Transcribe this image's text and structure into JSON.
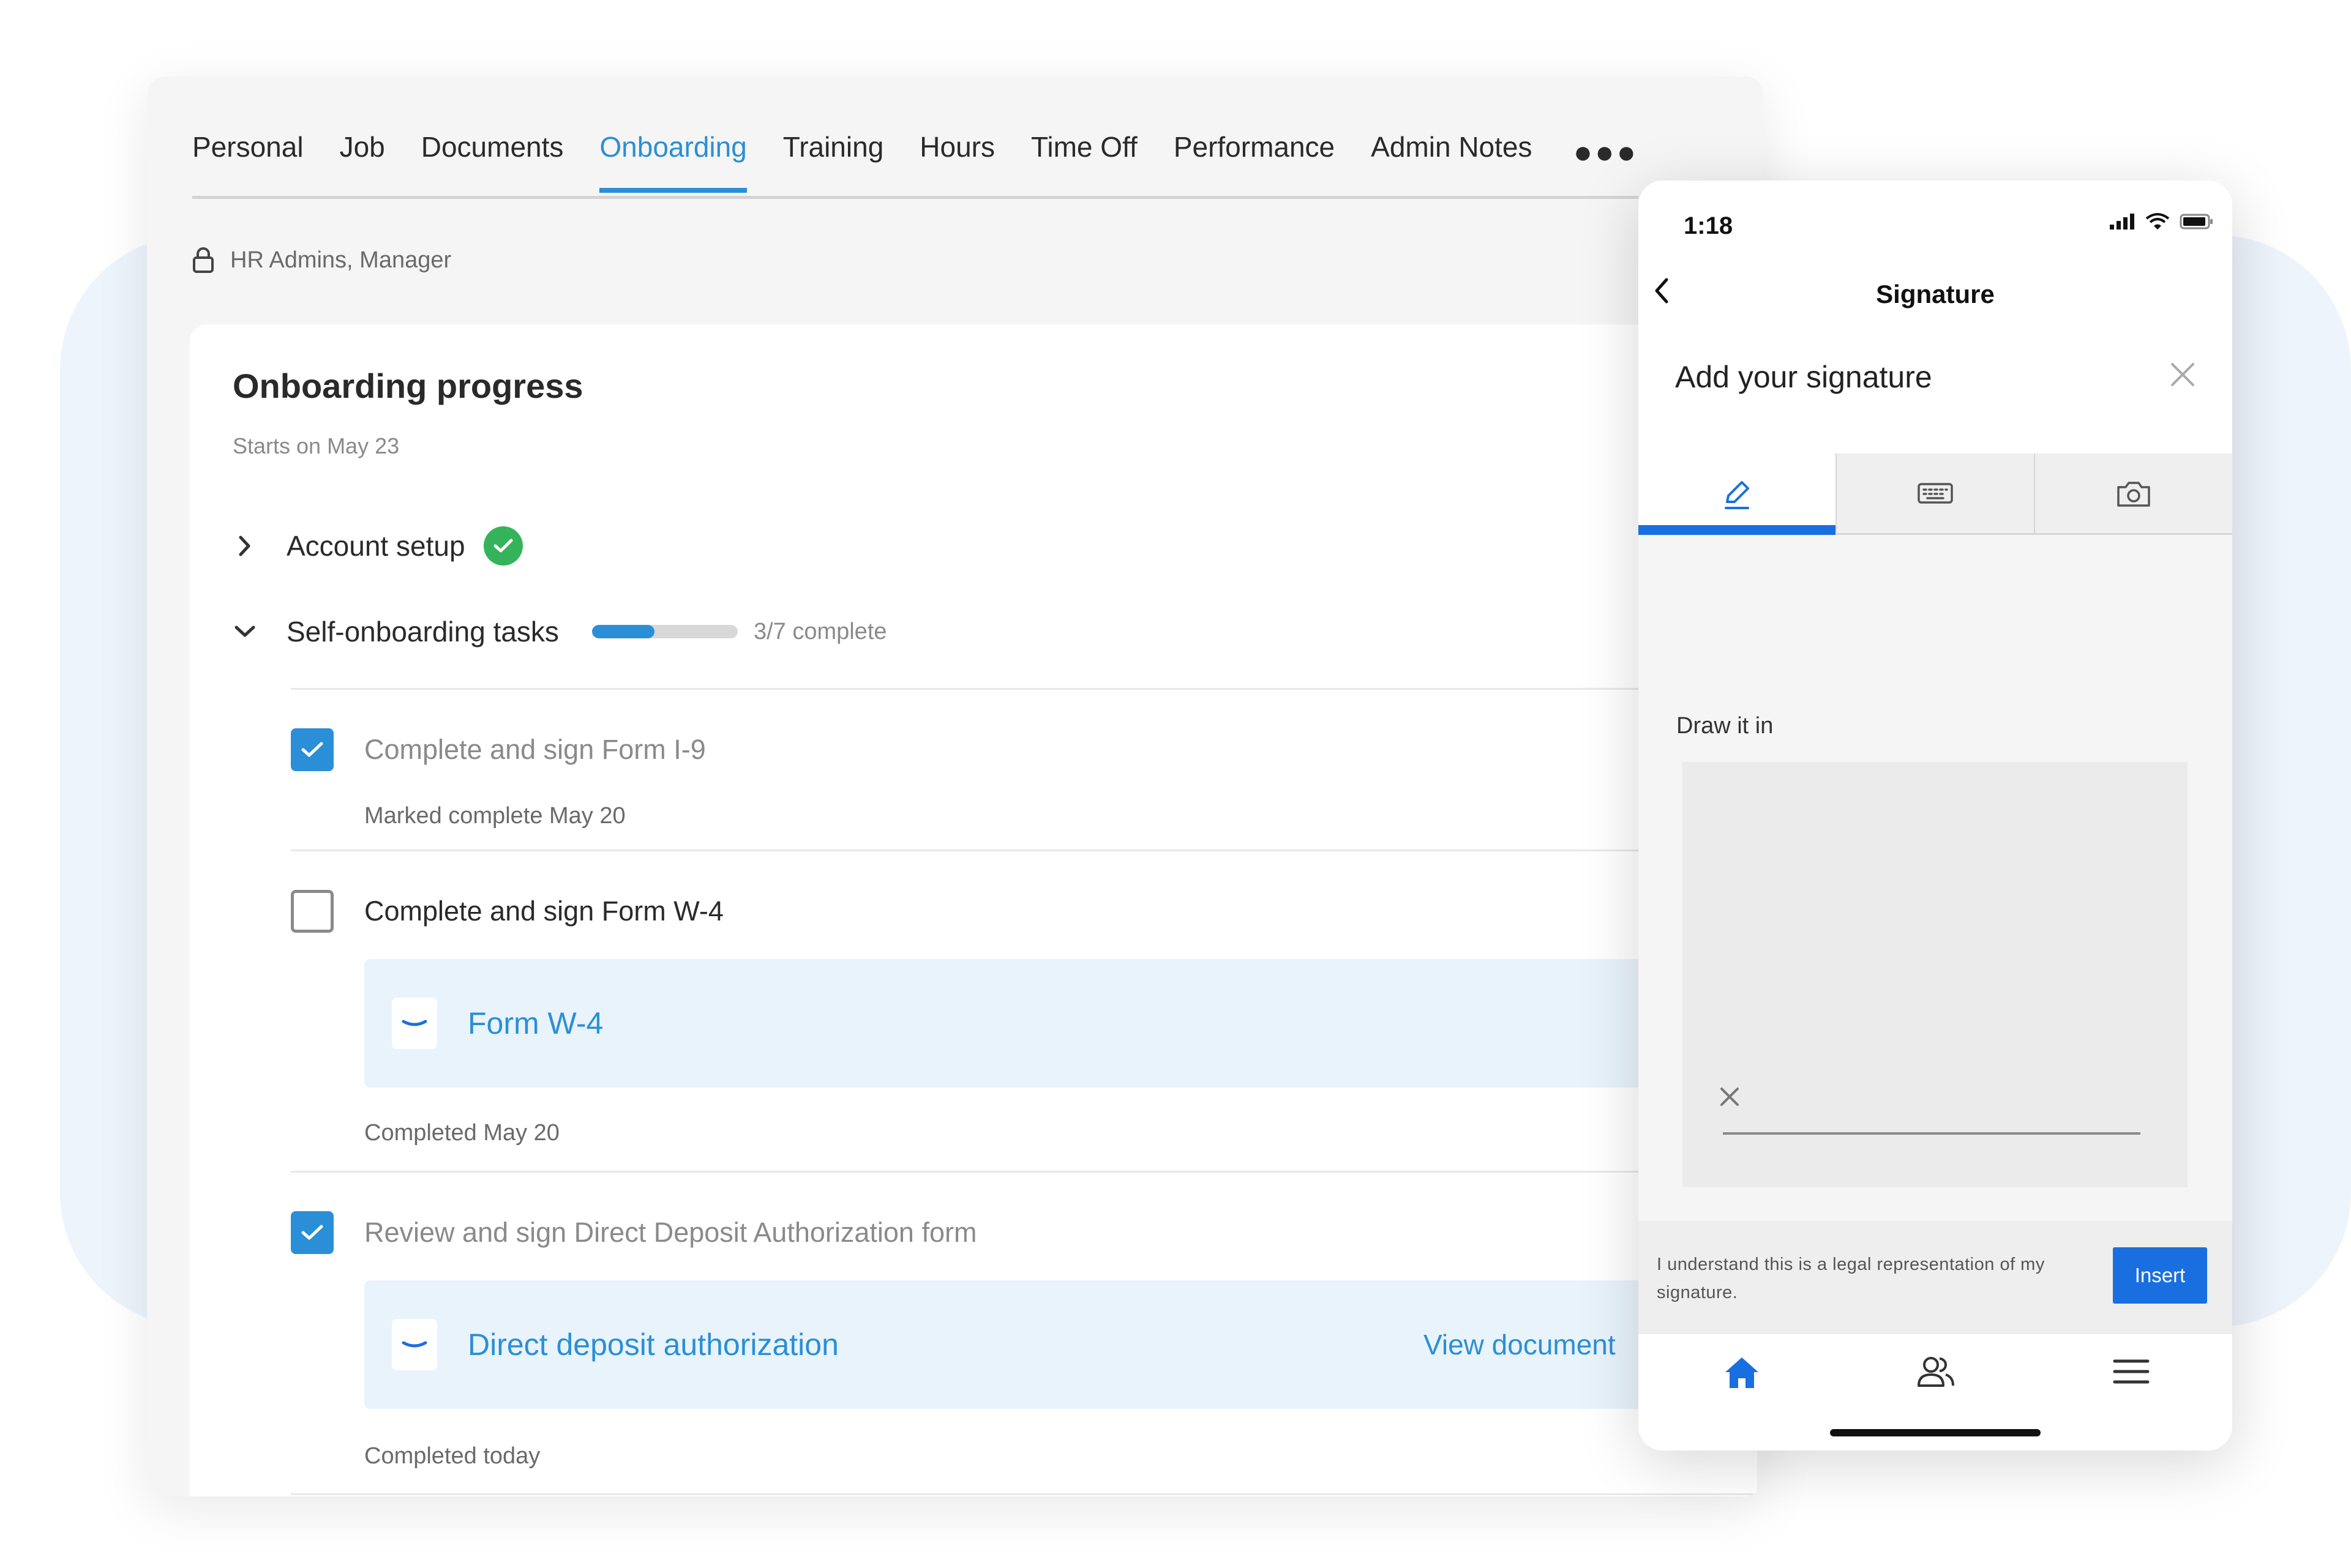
{
  "desktop": {
    "tabs": [
      {
        "label": "Personal",
        "active": false
      },
      {
        "label": "Job",
        "active": false
      },
      {
        "label": "Documents",
        "active": false
      },
      {
        "label": "Onboarding",
        "active": true
      },
      {
        "label": "Training",
        "active": false
      },
      {
        "label": "Hours",
        "active": false
      },
      {
        "label": "Time Off",
        "active": false
      },
      {
        "label": "Performance",
        "active": false
      },
      {
        "label": "Admin Notes",
        "active": false
      }
    ],
    "more_icon": "more-horizontal-icon",
    "access": {
      "icon": "lock-icon",
      "label": "HR Admins, Manager"
    },
    "card": {
      "title": "Onboarding progress",
      "subtitle": "Starts on May 23",
      "account_setup": {
        "label": "Account setup",
        "status_icon": "check-circle-icon"
      },
      "self_onboarding": {
        "label": "Self-onboarding tasks",
        "progress_fraction": 0.43,
        "progress_text": "3/7 complete"
      },
      "tasks": [
        {
          "label": "Complete and sign Form I-9",
          "checked": true,
          "meta": "Marked complete May 20"
        },
        {
          "label": "Complete and sign Form W-4",
          "checked": false,
          "document": {
            "title": "Form W-4"
          },
          "meta": "Completed May 20"
        },
        {
          "label": "Review and sign Direct Deposit Authorization form",
          "checked": true,
          "document": {
            "title": "Direct deposit authorization",
            "link": "View document"
          },
          "meta": "Completed today"
        }
      ]
    },
    "colors": {
      "accent": "#2a8fd6",
      "success": "#35b35a",
      "muted": "#8a8a8a"
    }
  },
  "phone": {
    "status_time": "1:18",
    "status_icons": [
      "signal-icon",
      "wifi-icon",
      "battery-icon"
    ],
    "nav_title": "Signature",
    "sheet": {
      "title": "Add your signature",
      "tabs": [
        {
          "icon": "pencil-icon",
          "active": true
        },
        {
          "icon": "keyboard-icon",
          "active": false
        },
        {
          "icon": "camera-icon",
          "active": false
        }
      ],
      "draw_label": "Draw it in",
      "legal_text": "I understand this is a legal representation of my signature.",
      "insert_label": "Insert"
    },
    "bottom_nav": [
      "home-icon",
      "people-icon",
      "menu-icon"
    ],
    "colors": {
      "primary": "#1a6fe0"
    }
  }
}
